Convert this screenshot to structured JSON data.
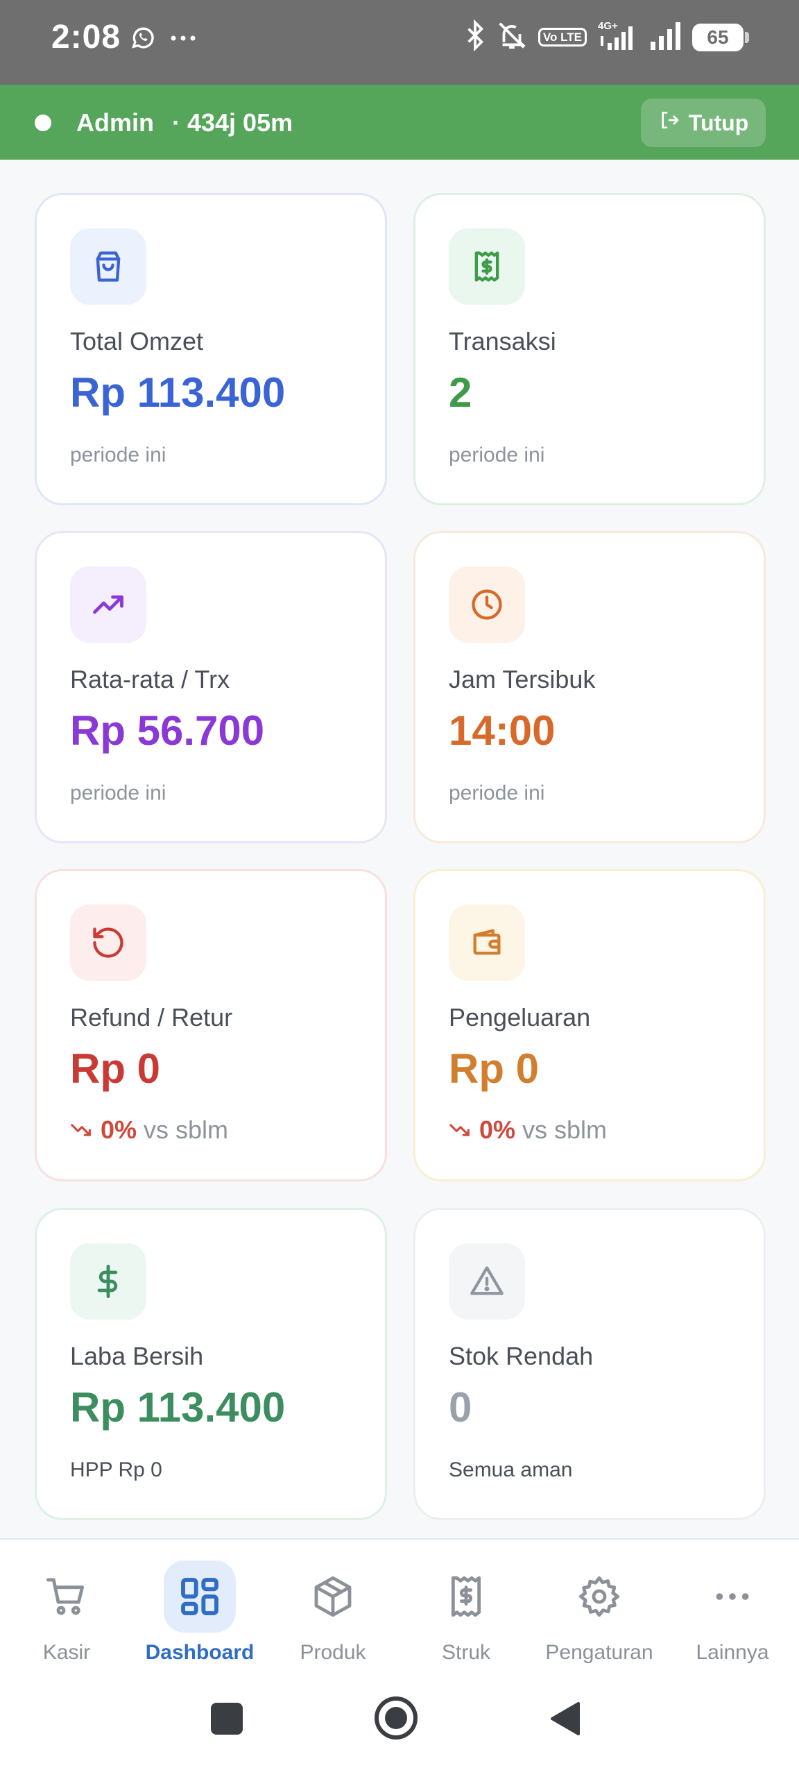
{
  "status_bar": {
    "time": "2:08",
    "battery": "65",
    "volte": "Vo LTE",
    "network": "4G+"
  },
  "session": {
    "user": "Admin",
    "duration": "· 434j 05m",
    "close_label": "Tutup"
  },
  "cards": [
    {
      "icon": "shopping-bag-icon",
      "label": "Total Omzet",
      "value": "Rp 113.400",
      "sub": "periode ini",
      "value_color": "#3a63d6"
    },
    {
      "icon": "receipt-dollar-icon",
      "label": "Transaksi",
      "value": "2",
      "sub": "periode ini",
      "value_color": "#3f9b4a"
    },
    {
      "icon": "trending-up-icon",
      "label": "Rata-rata / Trx",
      "value": "Rp 56.700",
      "sub": "periode ini",
      "value_color": "#8a38d6"
    },
    {
      "icon": "clock-icon",
      "label": "Jam Tersibuk",
      "value": "14:00",
      "sub": "periode ini",
      "value_color": "#d7692b"
    },
    {
      "icon": "refund-icon",
      "label": "Refund / Retur",
      "value": "Rp 0",
      "trend_pct": "0%",
      "trend_text": "vs sblm",
      "value_color": "#c93a35"
    },
    {
      "icon": "wallet-icon",
      "label": "Pengeluaran",
      "value": "Rp 0",
      "trend_pct": "0%",
      "trend_text": "vs sblm",
      "value_color": "#d17f2f"
    },
    {
      "icon": "dollar-icon",
      "label": "Laba Bersih",
      "value": "Rp 113.400",
      "sub": "HPP Rp 0",
      "value_color": "#3c8d5f"
    },
    {
      "icon": "warning-icon",
      "label": "Stok Rendah",
      "value": "0",
      "sub": "Semua aman",
      "value_color": "#9aa1aa"
    }
  ],
  "bottom_nav": [
    {
      "icon": "cart-icon",
      "label": "Kasir",
      "active": false
    },
    {
      "icon": "dashboard-icon",
      "label": "Dashboard",
      "active": true
    },
    {
      "icon": "box-icon",
      "label": "Produk",
      "active": false
    },
    {
      "icon": "receipt-icon",
      "label": "Struk",
      "active": false
    },
    {
      "icon": "gear-icon",
      "label": "Pengaturan",
      "active": false
    },
    {
      "icon": "more-icon",
      "label": "Lainnya",
      "active": false
    }
  ]
}
